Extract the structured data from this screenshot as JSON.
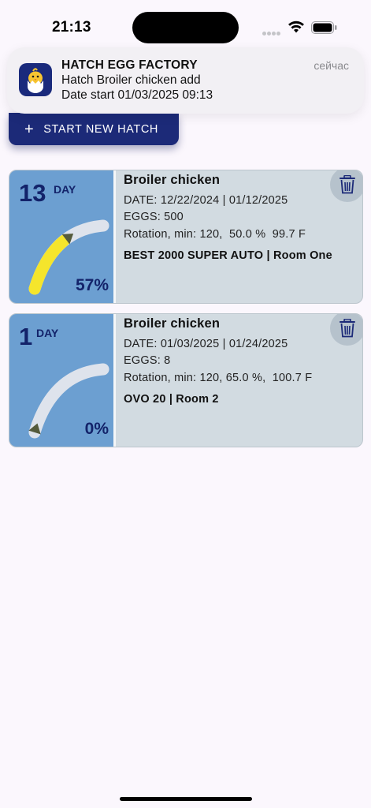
{
  "status_bar": {
    "time": "21:13",
    "icons": [
      "cellular-dots-icon",
      "wifi-icon",
      "battery-icon"
    ]
  },
  "notification": {
    "app_name": "HATCH EGG FACTORY",
    "time": "сейчас",
    "line1": "Hatch Broiler chicken add",
    "line2": "Date start 01/03/2025 09:13",
    "icon": "chick-in-egg-icon"
  },
  "start_button": {
    "label": "START NEW HATCH",
    "icon": "plus-icon"
  },
  "hatches": [
    {
      "day": "13",
      "day_label": "DAY",
      "percent_text": "57%",
      "progress": 0.57,
      "title": "Broiler chicken",
      "dates": "DATE: 12/22/2024 | 01/12/2025",
      "eggs": "EGGS: 500",
      "rotation": "Rotation, min: 120,  50.0 %  99.7 F",
      "device": "BEST 2000 SUPER AUTO | Room One",
      "delete_icon": "trash-icon"
    },
    {
      "day": "1",
      "day_label": "DAY",
      "percent_text": "0%",
      "progress": 0.0,
      "title": "Broiler chicken",
      "dates": "DATE: 01/03/2025 | 01/24/2025",
      "eggs": "EGGS: 8",
      "rotation": "Rotation, min: 120, 65.0 %,  100.7 F",
      "device": "OVO 20 | Room 2",
      "delete_icon": "trash-icon"
    }
  ],
  "colors": {
    "background": "#fbf7fd",
    "primary": "#1c2a78",
    "card_left": "#6c9fd1",
    "card_right": "#d2dbe1",
    "gauge_progress": "#f5e52c",
    "gauge_track": "#dee3ec",
    "text_dark_blue": "#13236a"
  }
}
